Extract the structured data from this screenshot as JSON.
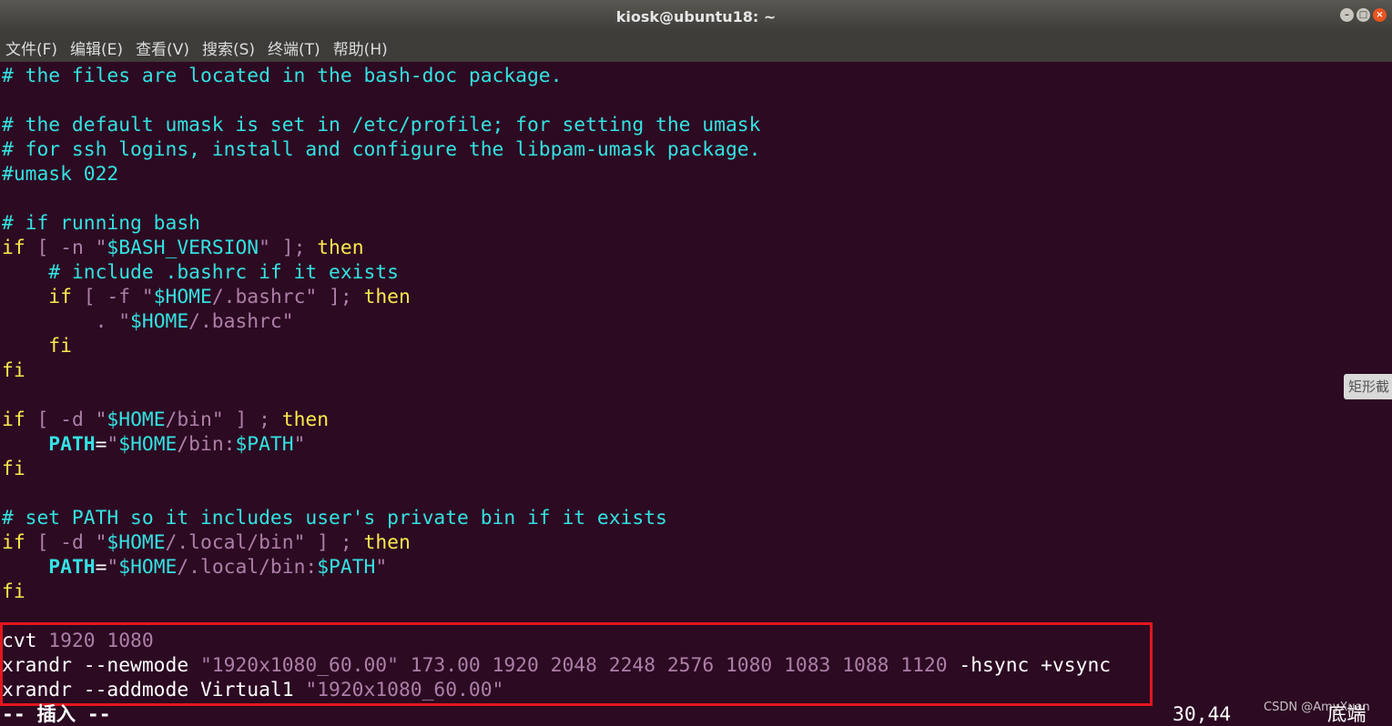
{
  "window": {
    "title": "kiosk@ubuntu18: ~",
    "buttons": {
      "minimize": "–",
      "maximize": "□",
      "close": "×"
    }
  },
  "menu": [
    "文件(F)",
    "编辑(E)",
    "查看(V)",
    "搜索(S)",
    "终端(T)",
    "帮助(H)"
  ],
  "lines": [
    [
      {
        "t": "# the files are located in the bash-doc package.",
        "c": "c"
      }
    ],
    [],
    [
      {
        "t": "# the default umask is set in /etc/profile; for setting the umask",
        "c": "c"
      }
    ],
    [
      {
        "t": "# for ssh logins, install and configure the libpam-umask package.",
        "c": "c"
      }
    ],
    [
      {
        "t": "#umask 022",
        "c": "c"
      }
    ],
    [],
    [
      {
        "t": "# if running bash",
        "c": "c"
      }
    ],
    [
      {
        "t": "if",
        "c": "y"
      },
      {
        "t": " [ -n ",
        "c": "m"
      },
      {
        "t": "\"",
        "c": "m"
      },
      {
        "t": "$BASH_VERSION",
        "c": "c"
      },
      {
        "t": "\"",
        "c": "m"
      },
      {
        "t": " ]; ",
        "c": "m"
      },
      {
        "t": "then",
        "c": "y"
      }
    ],
    [
      {
        "t": "    # include .bashrc if it exists",
        "c": "c"
      }
    ],
    [
      {
        "t": "    ",
        "c": "w"
      },
      {
        "t": "if",
        "c": "y"
      },
      {
        "t": " [ -f ",
        "c": "m"
      },
      {
        "t": "\"",
        "c": "m"
      },
      {
        "t": "$HOME",
        "c": "c"
      },
      {
        "t": "/.bashrc\"",
        "c": "m"
      },
      {
        "t": " ]; ",
        "c": "m"
      },
      {
        "t": "then",
        "c": "y"
      }
    ],
    [
      {
        "t": "        . ",
        "c": "m"
      },
      {
        "t": "\"",
        "c": "m"
      },
      {
        "t": "$HOME",
        "c": "c"
      },
      {
        "t": "/.bashrc\"",
        "c": "m"
      }
    ],
    [
      {
        "t": "    fi",
        "c": "y"
      }
    ],
    [
      {
        "t": "fi",
        "c": "y"
      }
    ],
    [],
    [
      {
        "t": "if",
        "c": "y"
      },
      {
        "t": " [ -d ",
        "c": "m"
      },
      {
        "t": "\"",
        "c": "m"
      },
      {
        "t": "$HOME",
        "c": "c"
      },
      {
        "t": "/bin\"",
        "c": "m"
      },
      {
        "t": " ] ; ",
        "c": "m"
      },
      {
        "t": "then",
        "c": "y"
      }
    ],
    [
      {
        "t": "    ",
        "c": "w"
      },
      {
        "t": "PATH",
        "c": "b"
      },
      {
        "t": "=",
        "c": "w"
      },
      {
        "t": "\"",
        "c": "m"
      },
      {
        "t": "$HOME",
        "c": "c"
      },
      {
        "t": "/bin:",
        "c": "m"
      },
      {
        "t": "$PATH",
        "c": "c"
      },
      {
        "t": "\"",
        "c": "m"
      }
    ],
    [
      {
        "t": "fi",
        "c": "y"
      }
    ],
    [],
    [
      {
        "t": "# set PATH so it includes user's private bin if it exists",
        "c": "c"
      }
    ],
    [
      {
        "t": "if",
        "c": "y"
      },
      {
        "t": " [ -d ",
        "c": "m"
      },
      {
        "t": "\"",
        "c": "m"
      },
      {
        "t": "$HOME",
        "c": "c"
      },
      {
        "t": "/.local/bin\"",
        "c": "m"
      },
      {
        "t": " ] ; ",
        "c": "m"
      },
      {
        "t": "then",
        "c": "y"
      }
    ],
    [
      {
        "t": "    ",
        "c": "w"
      },
      {
        "t": "PATH",
        "c": "b"
      },
      {
        "t": "=",
        "c": "w"
      },
      {
        "t": "\"",
        "c": "m"
      },
      {
        "t": "$HOME",
        "c": "c"
      },
      {
        "t": "/.local/bin:",
        "c": "m"
      },
      {
        "t": "$PATH",
        "c": "c"
      },
      {
        "t": "\"",
        "c": "m"
      }
    ],
    [
      {
        "t": "fi",
        "c": "y"
      }
    ],
    [],
    [
      {
        "t": "cvt ",
        "c": "w"
      },
      {
        "t": "1920 1080",
        "c": "m"
      }
    ],
    [
      {
        "t": "xrandr --newmode ",
        "c": "w"
      },
      {
        "t": "\"1920x1080_60.00\" 173.00 1920 2048 2248 2576 1080 1083 1088 1120",
        "c": "m"
      },
      {
        "t": " -hsync +vsync",
        "c": "w"
      }
    ],
    [
      {
        "t": "xrandr --addmode Virtual1 ",
        "c": "w"
      },
      {
        "t": "\"1920x1080_60.00\"",
        "c": "m"
      }
    ]
  ],
  "status": {
    "mode": "-- 插入 --",
    "position": "30,44",
    "scroll": "底端"
  },
  "watermark": "CSDN @AmyXuan",
  "side_tip": "矩形截"
}
